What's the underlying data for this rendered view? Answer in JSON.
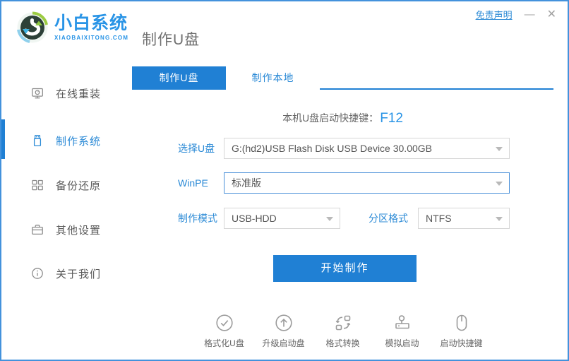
{
  "header": {
    "brand": "小白系统",
    "brand_domain": "XIAOBAIXITONG.COM",
    "title": "制作U盘",
    "disclaimer": "免责声明",
    "minimize": "—",
    "close": "✕"
  },
  "sidebar": {
    "items": [
      {
        "label": "在线重装",
        "icon": "monitor-reinstall-icon",
        "active": false
      },
      {
        "label": "制作系统",
        "icon": "usb-drive-icon",
        "active": true
      },
      {
        "label": "备份还原",
        "icon": "backup-grid-icon",
        "active": false
      },
      {
        "label": "其他设置",
        "icon": "toolbox-icon",
        "active": false
      },
      {
        "label": "关于我们",
        "icon": "info-circle-icon",
        "active": false
      }
    ]
  },
  "main": {
    "tabs": [
      {
        "label": "制作U盘",
        "active": true
      },
      {
        "label": "制作本地",
        "active": false
      }
    ],
    "hotkey": {
      "label": "本机U盘启动快捷键：",
      "value": "F12"
    },
    "form": {
      "usb_select": {
        "label": "选择U盘",
        "value": "G:(hd2)USB Flash Disk USB Device 30.00GB"
      },
      "winpe": {
        "label": "WinPE",
        "value": "标准版"
      },
      "mode": {
        "label": "制作模式",
        "value": "USB-HDD"
      },
      "partition": {
        "label": "分区格式",
        "value": "NTFS"
      }
    },
    "start_button": "开始制作",
    "footer_tools": [
      {
        "label": "格式化U盘",
        "icon": "check-circle-icon"
      },
      {
        "label": "升级启动盘",
        "icon": "arrow-up-circle-icon"
      },
      {
        "label": "格式转换",
        "icon": "convert-icon"
      },
      {
        "label": "模拟启动",
        "icon": "joystick-icon"
      },
      {
        "label": "启动快捷键",
        "icon": "mouse-icon"
      }
    ]
  },
  "colors": {
    "primary_blue": "#2080d4",
    "label_blue": "#2b8ad6",
    "brand_blue": "#2994e6",
    "window_border": "#4392dc",
    "dropdown_border": "#d6d6d6",
    "focused_border": "#4a90d9",
    "icon_gray": "#9b9b9b",
    "text_gray": "#666666"
  }
}
